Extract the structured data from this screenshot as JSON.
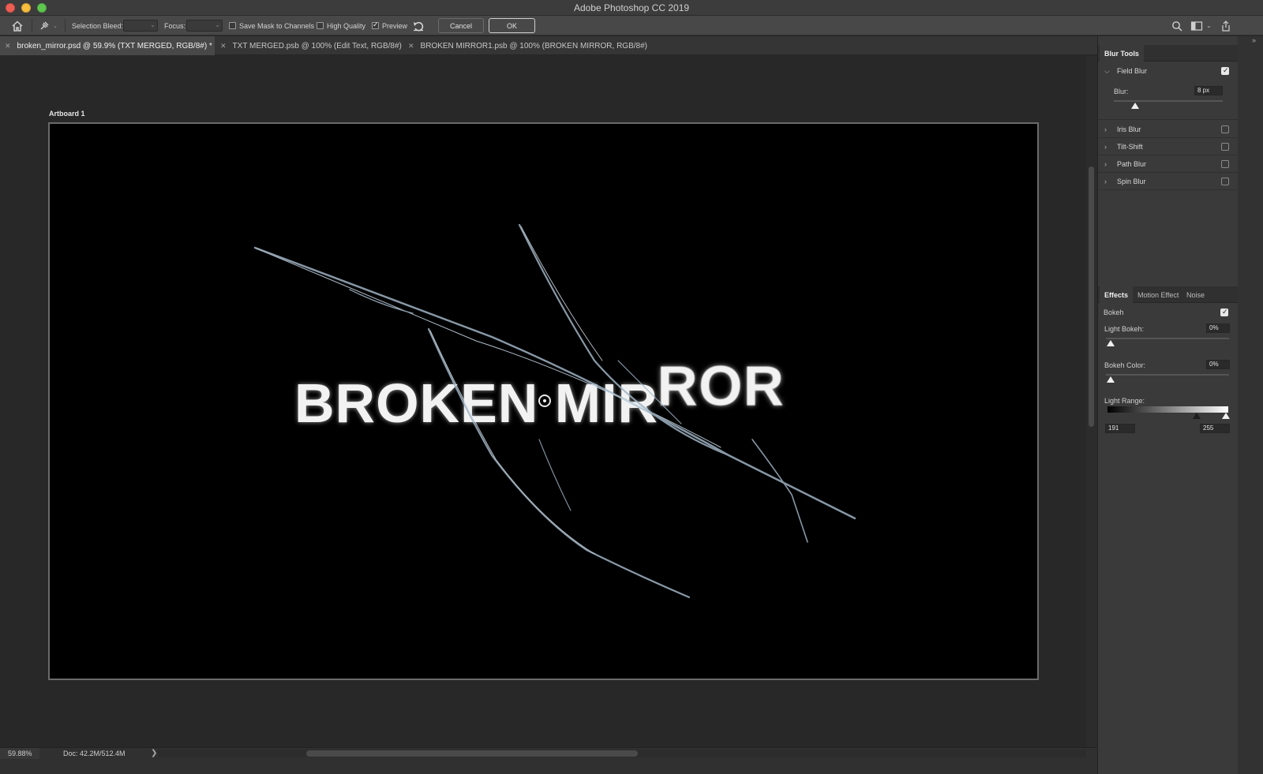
{
  "app": {
    "title": "Adobe Photoshop CC 2019"
  },
  "options_bar": {
    "selection_bleed_label": "Selection Bleed:",
    "focus_label": "Focus:",
    "save_mask_label": "Save Mask to Channels",
    "save_mask_checked": false,
    "high_quality_label": "High Quality",
    "high_quality_checked": false,
    "preview_label": "Preview",
    "preview_checked": true,
    "cancel_label": "Cancel",
    "ok_label": "OK"
  },
  "tabs": [
    {
      "label": "broken_mirror.psd @ 59.9% (TXT MERGED, RGB/8#) *",
      "active": true
    },
    {
      "label": "TXT MERGED.psb @ 100% (Edit Text, RGB/8#)",
      "active": false
    },
    {
      "label": "BROKEN MIRROR1.psb @ 100% (BROKEN MIRROR, RGB/8#)",
      "active": false
    }
  ],
  "canvas": {
    "artboard_label": "Artboard 1",
    "headline_part1": "BROKEN MIR",
    "headline_part2": "ROR"
  },
  "status": {
    "zoom": "59.88%",
    "doc": "Doc: 42.2M/512.4M",
    "arrow": "❯"
  },
  "blur_tools": {
    "tab_label": "Blur Tools",
    "field_blur": {
      "label": "Field Blur",
      "checked": true,
      "blur_label": "Blur:",
      "blur_value": "8 px",
      "blur_fraction": 0.06
    },
    "items": [
      {
        "label": "Iris Blur",
        "checked": false
      },
      {
        "label": "Tilt-Shift",
        "checked": false
      },
      {
        "label": "Path Blur",
        "checked": false
      },
      {
        "label": "Spin Blur",
        "checked": false
      }
    ]
  },
  "effects": {
    "tabs": [
      "Effects",
      "Motion Effect",
      "Noise"
    ],
    "bokeh_label": "Bokeh",
    "bokeh_checked": true,
    "light_bokeh_label": "Light Bokeh:",
    "light_bokeh_value": "0%",
    "bokeh_color_label": "Bokeh Color:",
    "bokeh_color_value": "0%",
    "light_range_label": "Light Range:",
    "light_range_low": "191",
    "light_range_high": "255"
  },
  "icons": [
    "home-icon",
    "pin-tool-icon",
    "reset-icon",
    "search-icon",
    "workspace-icon",
    "share-icon",
    "collapse-panels-icon"
  ]
}
